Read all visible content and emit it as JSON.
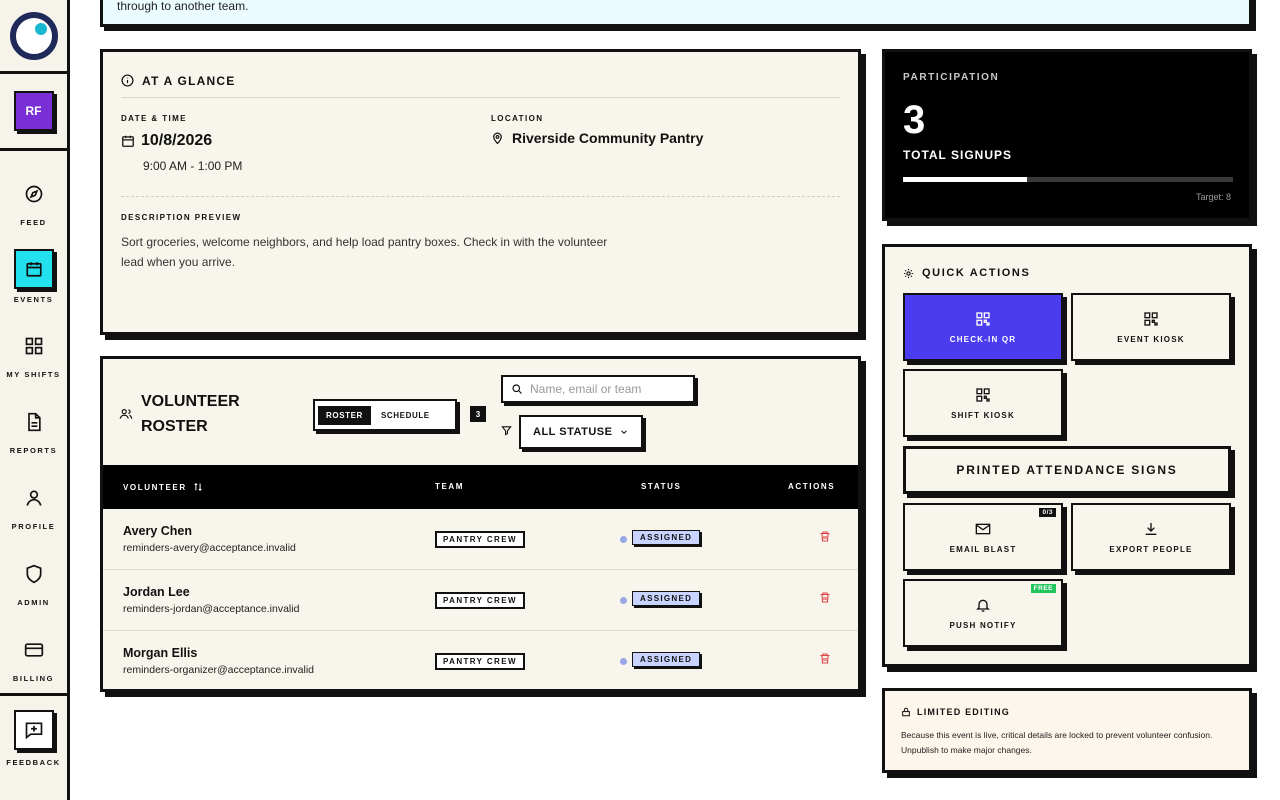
{
  "banner": {
    "text": "through to another team."
  },
  "sidebar": {
    "avatar_initials": "RF",
    "items": [
      {
        "label": "FEED",
        "icon": "compass-icon"
      },
      {
        "label": "EVENTS",
        "icon": "calendar-icon"
      },
      {
        "label": "MY SHIFTS",
        "icon": "grid-icon"
      },
      {
        "label": "REPORTS",
        "icon": "document-icon"
      },
      {
        "label": "PROFILE",
        "icon": "user-icon"
      },
      {
        "label": "ADMIN",
        "icon": "shield-icon"
      },
      {
        "label": "BILLING",
        "icon": "credit-card-icon"
      }
    ],
    "feedback_label": "FEEDBACK",
    "active_item": "EVENTS",
    "active_color": "#22e0ee"
  },
  "glance": {
    "title": "AT A GLANCE",
    "date_label": "DATE & TIME",
    "date": "10/8/2026",
    "time": "9:00 AM - 1:00 PM",
    "location_label": "LOCATION",
    "location": "Riverside Community Pantry",
    "description_label": "DESCRIPTION PREVIEW",
    "description": "Sort groceries, welcome neighbors, and help load pantry boxes. Check in with the volunteer lead when you arrive."
  },
  "participation": {
    "label": "PARTICIPATION",
    "count": "3",
    "sub": "TOTAL SIGNUPS",
    "progress_fraction": 0.375,
    "target": "Target: 8"
  },
  "quick_actions": {
    "title": "QUICK ACTIONS",
    "checkin_qr": "CHECK-IN QR",
    "event_kiosk": "EVENT KIOSK",
    "shift_kiosk": "SHIFT KIOSK",
    "printed_signs": "PRINTED ATTENDANCE SIGNS",
    "email_blast": "EMAIL BLAST",
    "email_badge": "0/3",
    "export_people": "EXPORT PEOPLE",
    "push_notify": "PUSH NOTIFY",
    "push_badge": "FREE",
    "primary_color": "#4b3cf0"
  },
  "limited": {
    "title": "LIMITED EDITING",
    "text": "Because this event is live, critical details are locked to prevent volunteer confusion. Unpublish to make major changes."
  },
  "roster": {
    "title": "VOLUNTEER ROSTER",
    "tab_roster": "ROSTER",
    "tab_schedule": "SCHEDULE",
    "count": "3",
    "search_placeholder": "Name, email or team",
    "status_filter": "ALL STATUSES",
    "columns": {
      "volunteer": "VOLUNTEER",
      "team": "TEAM",
      "status": "STATUS",
      "actions": "ACTIONS"
    },
    "rows": [
      {
        "name": "Avery Chen",
        "email": "reminders-avery@acceptance.invalid",
        "team": "PANTRY CREW",
        "status": "ASSIGNED"
      },
      {
        "name": "Jordan Lee",
        "email": "reminders-jordan@acceptance.invalid",
        "team": "PANTRY CREW",
        "status": "ASSIGNED"
      },
      {
        "name": "Morgan Ellis",
        "email": "reminders-organizer@acceptance.invalid",
        "team": "PANTRY CREW",
        "status": "ASSIGNED"
      }
    ]
  }
}
